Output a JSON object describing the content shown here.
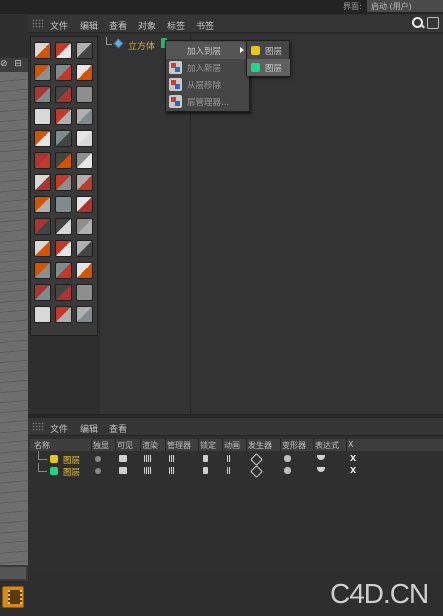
{
  "top": {
    "interface_label": "界面:",
    "interface_value": "启动 (用户)"
  },
  "object_manager": {
    "menu": [
      "文件",
      "编辑",
      "查看",
      "对象",
      "标签",
      "书签"
    ],
    "object_name": "立方体"
  },
  "context_menu": {
    "items": [
      {
        "label": "加入到层",
        "has_submenu": true,
        "highlighted": true
      },
      {
        "label": "加入新层"
      },
      {
        "label": "从层移除"
      },
      {
        "label": "层管理器..."
      }
    ],
    "submenu": [
      {
        "label": "图层",
        "color": "#e6c619"
      },
      {
        "label": "图层",
        "color": "#1fd68a",
        "highlighted": true
      }
    ]
  },
  "layer_manager": {
    "menu": [
      "文件",
      "编辑",
      "查看"
    ],
    "columns": [
      "名称",
      "独显",
      "可见",
      "渲染",
      "管理器",
      "锁定",
      "动画",
      "发生器",
      "变形器",
      "表达式",
      "X"
    ],
    "rows": [
      {
        "name": "图层",
        "color": "#e6c619"
      },
      {
        "name": "图层",
        "color": "#1fd68a"
      }
    ]
  },
  "watermark": "C4D.CN"
}
